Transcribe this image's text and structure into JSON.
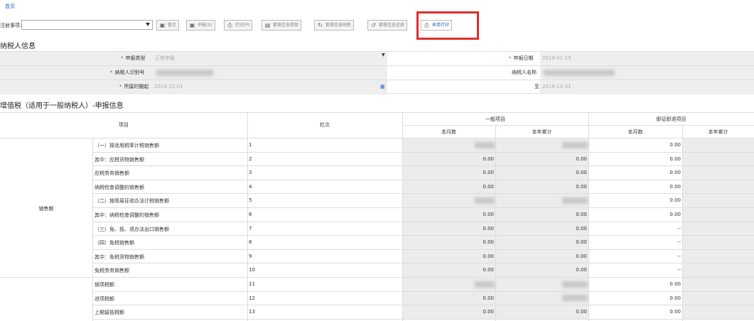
{
  "nav": {
    "home": "首页"
  },
  "toolbar": {
    "notice_label": "注射事项:",
    "buttons": [
      {
        "label": "暂存",
        "icon": "save-icon"
      },
      {
        "label": "申报(S)",
        "icon": "submit-icon"
      },
      {
        "label": "打印(P)",
        "icon": "print-icon"
      },
      {
        "label": "套餐信息提取",
        "icon": "extract-icon"
      },
      {
        "label": "套餐信息刷新",
        "icon": "refresh-icon"
      },
      {
        "label": "套餐信息还原",
        "icon": "restore-icon"
      },
      {
        "label": "表单打印",
        "icon": "print-icon"
      }
    ]
  },
  "taxpayer": {
    "title": "纳税人信息",
    "declare_type_label": "申报类型",
    "declare_type_value": "正常申报",
    "declare_date_label": "申报日期",
    "declare_date_value": "2019-01-15",
    "tax_id_label": "纳税人识别号",
    "tax_name_label": "纳税人名称",
    "period_start_label": "所属时期起",
    "period_start_value": "2018-12-01",
    "period_end_label": "至",
    "period_end_value": "2018-12-31"
  },
  "vat": {
    "title": "增值税（适用于一般纳税人）-申报信息",
    "headers": {
      "item": "项目",
      "row_no": "栏次",
      "general": "一般项目",
      "refund": "即征即退项目",
      "month": "本月数",
      "year": "本年累计"
    },
    "group_sales": "销售额",
    "rows": [
      {
        "label": "（一）按适用税率计税销售额",
        "no": "1",
        "m": "",
        "y": "",
        "rm": "0.00",
        "blur": true
      },
      {
        "label": "其中：应税货物销售额",
        "no": "2",
        "m": "0.00",
        "y": "0.00",
        "rm": "0.00"
      },
      {
        "label": "应税劳务销售额",
        "no": "3",
        "m": "0.00",
        "y": "0.00",
        "rm": "0.00"
      },
      {
        "label": "纳税检查调整的销售额",
        "no": "4",
        "m": "0.00",
        "y": "0.00",
        "rm": "0.00"
      },
      {
        "label": "（二）按简易征收办法计税销售额",
        "no": "5",
        "m": "",
        "y": "",
        "rm": "0.00",
        "blur": true
      },
      {
        "label": "其中：纳税检查调整的销售额",
        "no": "6",
        "m": "0.00",
        "y": "0.00",
        "rm": "0.00"
      },
      {
        "label": "（三）免、抵、退办法出口销售额",
        "no": "7",
        "m": "0.00",
        "y": "0.00",
        "rm": "--"
      },
      {
        "label": "（四）免税销售额",
        "no": "8",
        "m": "0.00",
        "y": "0.00",
        "rm": "--"
      },
      {
        "label": "其中：免税货物销售额",
        "no": "9",
        "m": "0.00",
        "y": "0.00",
        "rm": "--"
      },
      {
        "label": "免税劳务销售额",
        "no": "10",
        "m": "0.00",
        "y": "0.00",
        "rm": "--"
      },
      {
        "label": "销项税额",
        "no": "11",
        "m": "",
        "y": "",
        "rm": "0.00",
        "blur": true
      },
      {
        "label": "进项税额",
        "no": "12",
        "m": "0.00",
        "y": "",
        "rm": "0.00",
        "blury": true
      },
      {
        "label": "上期留抵税额",
        "no": "13",
        "m": "0.00",
        "y": "0.00",
        "rm": "0.00"
      }
    ]
  }
}
